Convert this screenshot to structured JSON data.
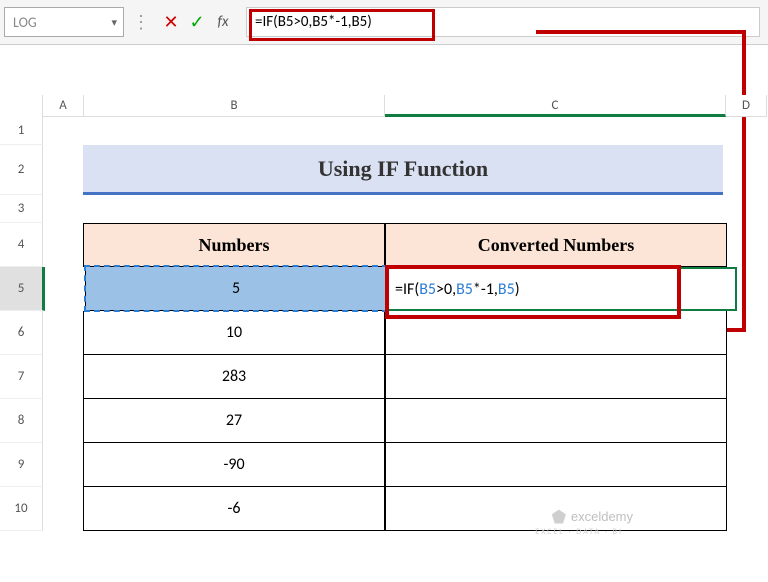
{
  "nameBox": "LOG",
  "formulaBar": "=IF(B5>0,B5*-1,B5)",
  "columns": {
    "A": "A",
    "B": "B",
    "C": "C",
    "D": "D"
  },
  "rows": [
    "1",
    "2",
    "3",
    "4",
    "5",
    "6",
    "7",
    "8",
    "9",
    "10"
  ],
  "title": "Using IF Function",
  "headers": {
    "numbers": "Numbers",
    "converted": "Converted Numbers"
  },
  "data": {
    "b5": "5",
    "b6": "10",
    "b7": "283",
    "b8": "27",
    "b9": "-90",
    "b10": "-6"
  },
  "cellFormula": "=IF(B5>0,B5*-1,B5)",
  "watermark": {
    "name": "exceldemy",
    "tagline": "EXCEL · DATA · BI"
  },
  "chart_data": null
}
